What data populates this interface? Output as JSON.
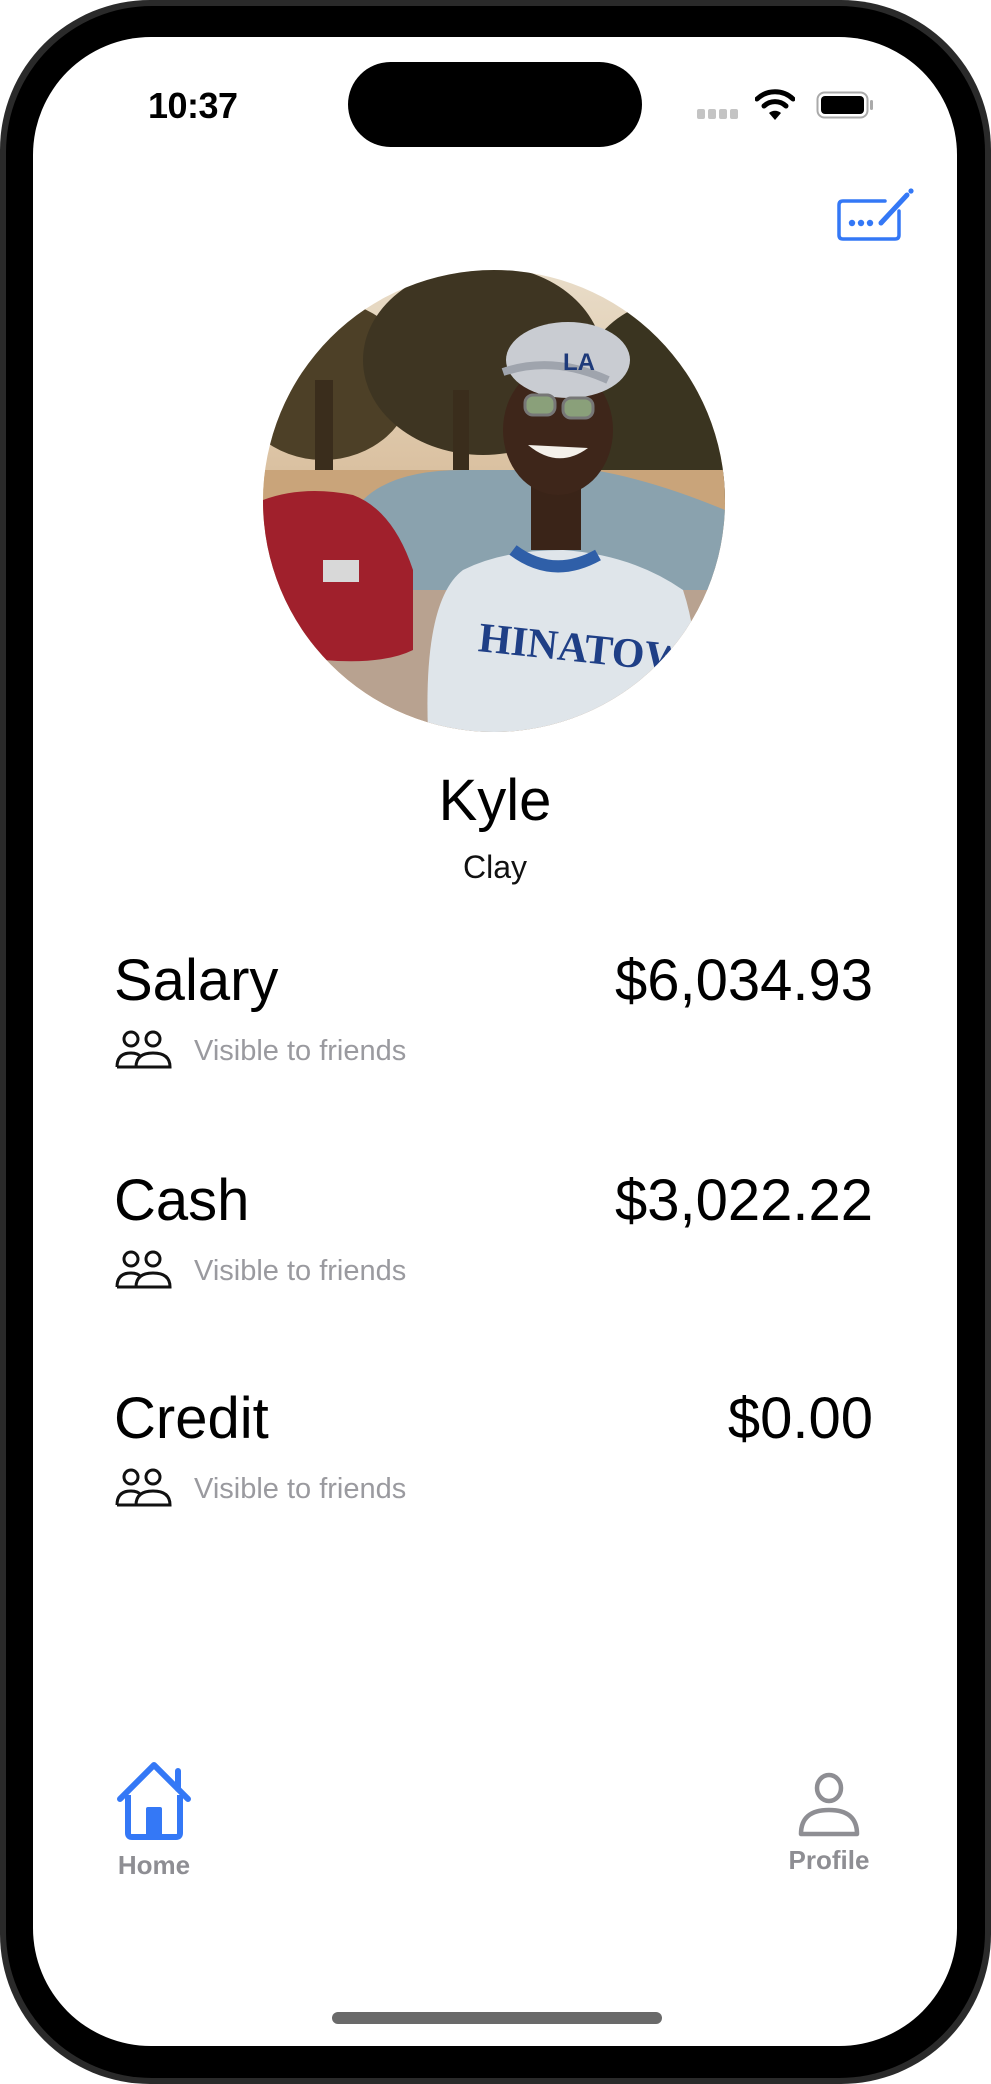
{
  "status_bar": {
    "time": "10:37",
    "icons": [
      "signal-dots-icon",
      "wifi-icon",
      "battery-icon"
    ]
  },
  "header": {
    "edit_button_icon": "signature-pencil-icon"
  },
  "profile": {
    "avatar_alt": "Profile photo of a smiling man in a cap and a CHINATOWN t-shirt in a parking lot",
    "first_name": "Kyle",
    "last_name": "Clay"
  },
  "accounts": [
    {
      "label": "Salary",
      "amount": "$6,034.93",
      "visibility": "Visible to friends",
      "visibility_icon": "two-people-icon"
    },
    {
      "label": "Cash",
      "amount": "$3,022.22",
      "visibility": "Visible to friends",
      "visibility_icon": "two-people-icon"
    },
    {
      "label": "Credit",
      "amount": "$0.00",
      "visibility": "Visible to friends",
      "visibility_icon": "two-people-icon"
    }
  ],
  "tab_bar": {
    "tabs": [
      {
        "label": "Home",
        "icon": "house-icon",
        "active": true
      },
      {
        "label": "Profile",
        "icon": "person-icon",
        "active": false
      }
    ]
  },
  "colors": {
    "accent": "#3478f6",
    "inactive": "#8e8e93",
    "secondary_text": "#9a9a9f"
  }
}
